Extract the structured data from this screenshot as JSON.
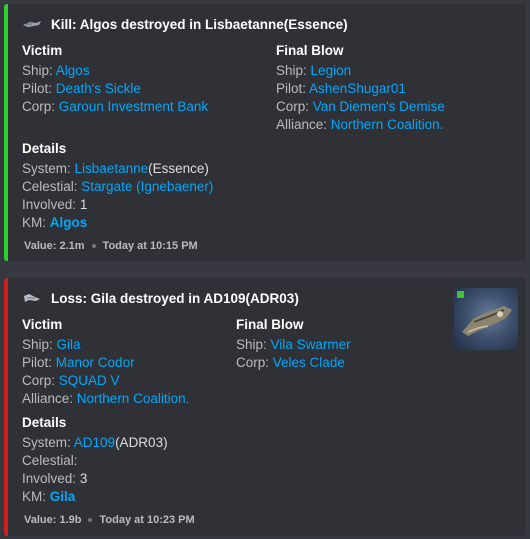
{
  "kill": {
    "title": "Kill: Algos destroyed in Lisbaetanne(Essence)",
    "accent_color": "#2ed12e",
    "victim": {
      "heading": "Victim",
      "ship_label": "Ship:",
      "ship": "Algos",
      "pilot_label": "Pilot:",
      "pilot": "Death's Sickle",
      "corp_label": "Corp:",
      "corp": "Garoun Investment Bank"
    },
    "final_blow": {
      "heading": "Final Blow",
      "ship_label": "Ship:",
      "ship": "Legion",
      "pilot_label": "Pilot:",
      "pilot": "AshenShugar01",
      "corp_label": "Corp:",
      "corp": "Van Diemen's Demise",
      "alliance_label": "Alliance:",
      "alliance": "Northern Coalition."
    },
    "details": {
      "heading": "Details",
      "system_label": "System:",
      "system": "Lisbaetanne",
      "system_region": "(Essence)",
      "celestial_label": "Celestial:",
      "celestial": "Stargate (Ignebaener)",
      "involved_label": "Involved:",
      "involved": "1",
      "km_label": "KM:",
      "km": "Algos"
    },
    "footer": {
      "value": "Value: 2.1m",
      "time": "Today at 10:15 PM"
    }
  },
  "loss": {
    "title": "Loss: Gila destroyed in AD109(ADR03)",
    "accent_color": "#cc1f1f",
    "victim": {
      "heading": "Victim",
      "ship_label": "Ship:",
      "ship": "Gila",
      "pilot_label": "Pilot:",
      "pilot": "Manor Codor",
      "corp_label": "Corp:",
      "corp": "SQUAD V",
      "alliance_label": "Alliance:",
      "alliance": "Northern Coalition."
    },
    "final_blow": {
      "heading": "Final Blow",
      "ship_label": "Ship:",
      "ship": "Vila Swarmer",
      "corp_label": "Corp:",
      "corp": "Veles Clade"
    },
    "details": {
      "heading": "Details",
      "system_label": "System:",
      "system": "AD109",
      "system_region": "(ADR03)",
      "celestial_label": "Celestial:",
      "involved_label": "Involved:",
      "involved": "3",
      "km_label": "KM:",
      "km": "Gila"
    },
    "footer": {
      "value": "Value: 1.9b",
      "time": "Today at 10:23 PM"
    },
    "thumbnail_icon": "ship-thumbnail-icon"
  },
  "icons": {
    "header_kill": "ship-icon",
    "header_loss": "ship-icon"
  }
}
